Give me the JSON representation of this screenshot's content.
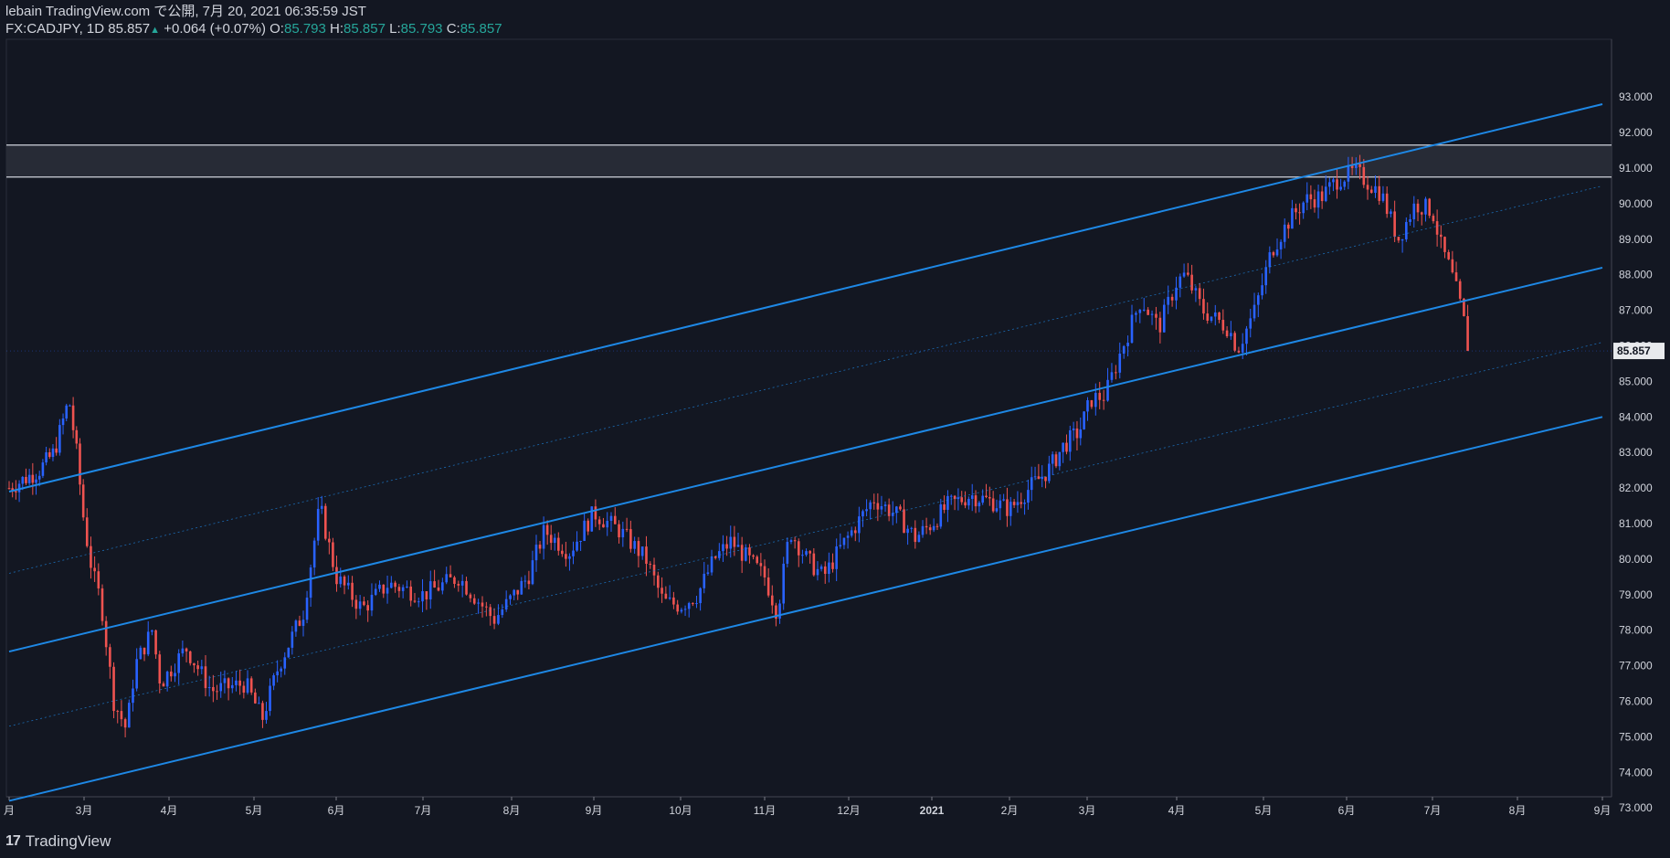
{
  "header": {
    "line1": "lebain TradingView.com で公開, 7月 20, 2021 06:35:59 JST",
    "symbol": "FX:CADJPY, 1D",
    "last": "85.857",
    "change": "+0.064 (+0.07%)",
    "o_label": "O:",
    "o_value": "85.793",
    "h_label": "H:",
    "h_value": "85.857",
    "l_label": "L:",
    "l_value": "85.793",
    "c_label": "C:",
    "c_value": "85.857"
  },
  "footer": {
    "brand": "TradingView",
    "logo": "17"
  },
  "colors": {
    "background": "#131722",
    "up": "#2962ff",
    "down": "#ef5350",
    "line": "#1e88e5",
    "text": "#d1d4dc",
    "teal": "#26a69a"
  },
  "chart_data": {
    "type": "candlestick",
    "symbol": "FX:CADJPY",
    "timeframe": "1D",
    "ylim": [
      72.0,
      93.2
    ],
    "y_ticks": [
      "73.000",
      "74.000",
      "75.000",
      "76.000",
      "77.000",
      "78.000",
      "79.000",
      "80.000",
      "81.000",
      "82.000",
      "83.000",
      "84.000",
      "85.000",
      "86.000",
      "87.000",
      "88.000",
      "89.000",
      "90.000",
      "91.000",
      "92.000",
      "93.000"
    ],
    "x_labels": [
      "月",
      "3月",
      "4月",
      "5月",
      "6月",
      "7月",
      "8月",
      "9月",
      "10月",
      "11月",
      "12月",
      "2021",
      "2月",
      "3月",
      "4月",
      "5月",
      "6月",
      "7月",
      "8月",
      "9月"
    ],
    "last_price_label": "85.857",
    "resistance_zone": [
      90.75,
      91.65
    ],
    "channels": [
      {
        "name": "upper",
        "start": [
          0,
          81.9
        ],
        "end": [
          19,
          92.8
        ]
      },
      {
        "name": "mid-upper-dotted",
        "start": [
          0,
          79.6
        ],
        "end": [
          19,
          90.5
        ]
      },
      {
        "name": "middle",
        "start": [
          0,
          77.4
        ],
        "end": [
          19,
          88.2
        ]
      },
      {
        "name": "mid-lower-dotted",
        "start": [
          0,
          75.3
        ],
        "end": [
          19,
          86.1
        ]
      },
      {
        "name": "lower",
        "start": [
          0,
          73.2
        ],
        "end": [
          19,
          84.0
        ]
      }
    ],
    "anchors": [
      [
        0,
        82.0
      ],
      [
        0.4,
        82.5
      ],
      [
        0.6,
        83.0
      ],
      [
        0.8,
        84.5
      ],
      [
        0.9,
        83.0
      ],
      [
        1.0,
        81.0
      ],
      [
        1.1,
        79.6
      ],
      [
        1.2,
        78.8
      ],
      [
        1.35,
        76.0
      ],
      [
        1.5,
        75.2
      ],
      [
        1.6,
        77.0
      ],
      [
        1.8,
        78.0
      ],
      [
        1.9,
        76.5
      ],
      [
        2.2,
        77.5
      ],
      [
        2.5,
        76.3
      ],
      [
        2.9,
        76.5
      ],
      [
        3.1,
        75.5
      ],
      [
        3.3,
        77.0
      ],
      [
        3.6,
        78.5
      ],
      [
        3.8,
        81.5
      ],
      [
        4.0,
        79.5
      ],
      [
        4.3,
        78.6
      ],
      [
        4.6,
        79.3
      ],
      [
        5.0,
        79.0
      ],
      [
        5.4,
        79.5
      ],
      [
        5.8,
        78.3
      ],
      [
        6.2,
        79.5
      ],
      [
        6.4,
        80.8
      ],
      [
        6.7,
        80.2
      ],
      [
        7.0,
        81.3
      ],
      [
        7.3,
        80.8
      ],
      [
        7.6,
        80.0
      ],
      [
        7.8,
        78.8
      ],
      [
        8.0,
        78.7
      ],
      [
        8.2,
        79.0
      ],
      [
        8.4,
        80.0
      ],
      [
        8.6,
        80.5
      ],
      [
        8.8,
        80.0
      ],
      [
        9.0,
        79.5
      ],
      [
        9.15,
        78.5
      ],
      [
        9.3,
        80.8
      ],
      [
        9.5,
        80.0
      ],
      [
        9.7,
        79.5
      ],
      [
        9.9,
        80.3
      ],
      [
        10.1,
        81.0
      ],
      [
        10.3,
        81.7
      ],
      [
        10.6,
        81.2
      ],
      [
        10.8,
        80.6
      ],
      [
        11.0,
        81.0
      ],
      [
        11.2,
        81.5
      ],
      [
        11.5,
        81.8
      ],
      [
        11.8,
        81.6
      ],
      [
        12.0,
        81.4
      ],
      [
        12.3,
        82.1
      ],
      [
        12.5,
        82.5
      ],
      [
        12.7,
        83.2
      ],
      [
        12.9,
        83.6
      ],
      [
        13.05,
        84.5
      ],
      [
        13.2,
        84.6
      ],
      [
        13.4,
        86.0
      ],
      [
        13.6,
        87.3
      ],
      [
        13.8,
        86.5
      ],
      [
        14.0,
        87.8
      ],
      [
        14.1,
        88.0
      ],
      [
        14.3,
        87.0
      ],
      [
        14.6,
        86.5
      ],
      [
        14.7,
        85.9
      ],
      [
        14.9,
        87.0
      ],
      [
        15.1,
        88.7
      ],
      [
        15.3,
        89.5
      ],
      [
        15.5,
        90.1
      ],
      [
        15.7,
        90.2
      ],
      [
        15.9,
        90.7
      ],
      [
        16.1,
        90.9
      ],
      [
        16.3,
        90.5
      ],
      [
        16.4,
        90.3
      ],
      [
        16.6,
        89.0
      ],
      [
        16.8,
        90.0
      ],
      [
        17.0,
        89.8
      ],
      [
        17.1,
        88.8
      ],
      [
        17.2,
        88.2
      ],
      [
        17.3,
        87.4
      ],
      [
        17.45,
        85.86
      ]
    ],
    "last_close": 85.857
  }
}
